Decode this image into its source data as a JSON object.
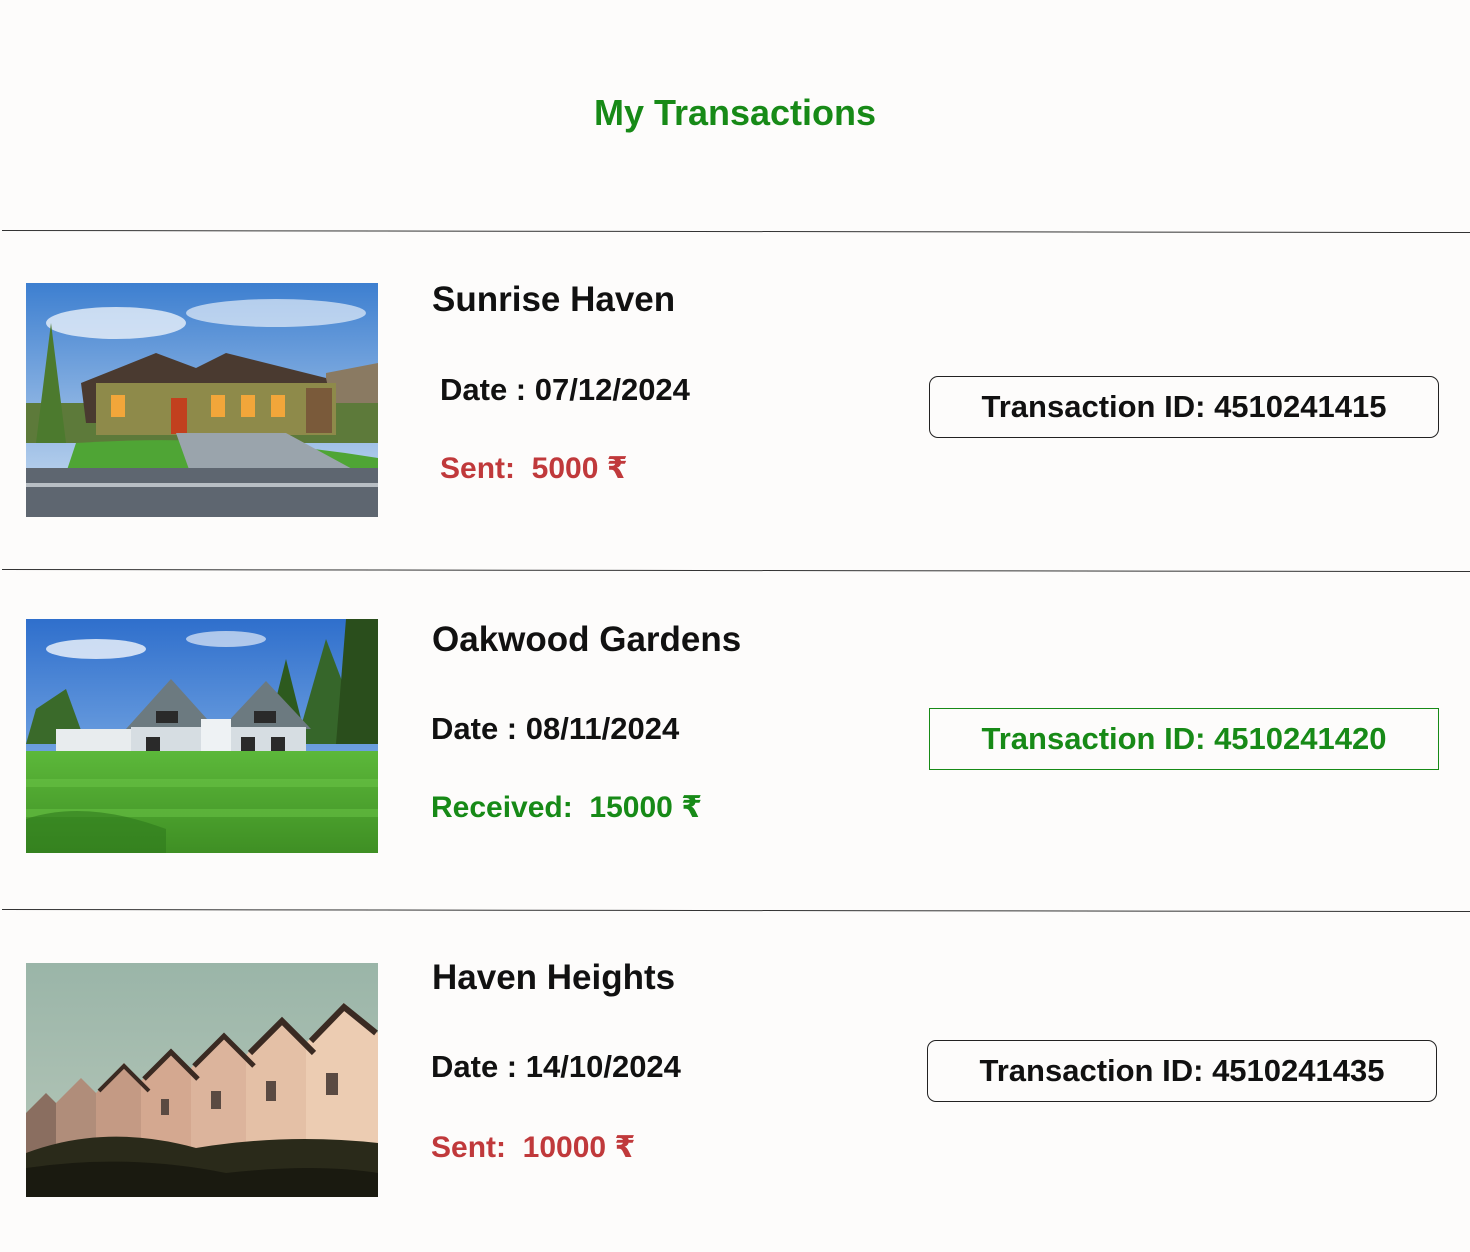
{
  "header": {
    "title": "My Transactions"
  },
  "colors": {
    "accent_green": "#178a17",
    "sent_red": "#c0393b",
    "text": "#111111",
    "background": "#fdfcfb"
  },
  "transactions": [
    {
      "property": "Sunrise Haven",
      "date_label": "Date :",
      "date": "07/12/2024",
      "amount_label": "Sent:",
      "amount": "5000",
      "currency": "₹",
      "direction": "sent",
      "transaction_id_label": "Transaction ID:",
      "transaction_id": "4510241415",
      "image": "suburban-house-photo"
    },
    {
      "property": "Oakwood Gardens",
      "date_label": "Date :",
      "date": "08/11/2024",
      "amount_label": "Received:",
      "amount": "15000",
      "currency": "₹",
      "direction": "received",
      "transaction_id_label": "Transaction ID:",
      "transaction_id": "4510241420",
      "image": "white-house-lawn-photo"
    },
    {
      "property": "Haven Heights",
      "date_label": "Date :",
      "date": "14/10/2024",
      "amount_label": "Sent:",
      "amount": "10000",
      "currency": "₹",
      "direction": "sent",
      "transaction_id_label": "Transaction ID:",
      "transaction_id": "4510241435",
      "image": "victorian-row-houses-photo"
    }
  ]
}
